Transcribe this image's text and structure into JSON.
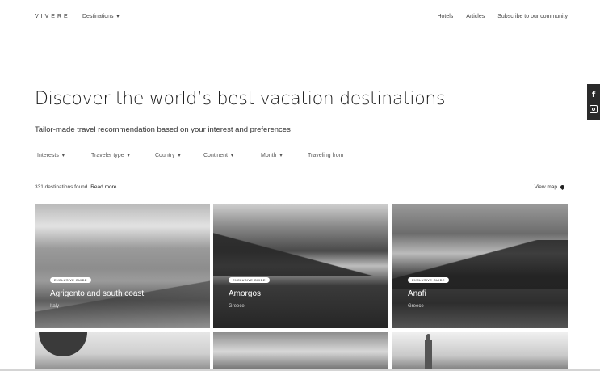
{
  "nav": {
    "logo": "VIVERE",
    "destinations_label": "Destinations",
    "links": [
      "Hotels",
      "Articles",
      "Subscribe to our community"
    ]
  },
  "social": {
    "facebook_glyph": "f",
    "icons": [
      "facebook-icon",
      "instagram-icon"
    ]
  },
  "hero": {
    "title": "Discover the world’s best vacation destinations",
    "subtitle": "Tailor-made travel recommendation based on your interest and preferences"
  },
  "filters": [
    {
      "label": "Interests",
      "dropdown": true
    },
    {
      "label": "Traveler type",
      "dropdown": true
    },
    {
      "label": "Country",
      "dropdown": true
    },
    {
      "label": "Continent",
      "dropdown": true
    },
    {
      "label": "Month",
      "dropdown": true
    },
    {
      "label": "Traveling from",
      "dropdown": false
    }
  ],
  "results": {
    "count_text": "331 destinations found",
    "read_more": "Read more",
    "view_map": "View map"
  },
  "cards": [
    {
      "badge": "EXCLUSIVE GUIDE",
      "title": "Agrigento and south coast",
      "country": "Italy"
    },
    {
      "badge": "EXCLUSIVE GUIDE",
      "title": "Amorgos",
      "country": "Greece"
    },
    {
      "badge": "EXCLUSIVE GUIDE",
      "title": "Anafi",
      "country": "Greece"
    }
  ],
  "colors": {
    "text": "#222222",
    "social_bar": "#2a2a2a",
    "background": "#ffffff"
  }
}
